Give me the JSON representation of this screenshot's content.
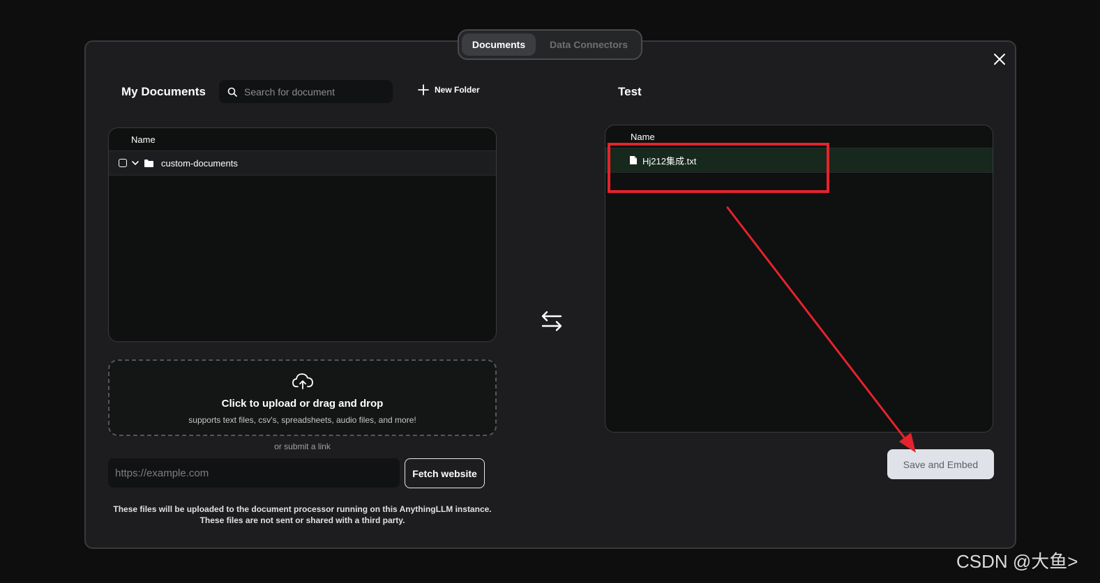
{
  "tabs": [
    {
      "label": "Documents"
    },
    {
      "label": "Data Connectors"
    }
  ],
  "my_documents": {
    "title": "My Documents",
    "search_placeholder": "Search for document",
    "new_folder_label": "New Folder",
    "column_name": "Name",
    "folders": [
      {
        "name": "custom-documents"
      }
    ]
  },
  "upload": {
    "title": "Click to upload or drag and drop",
    "subtitle": "supports text files, csv's, spreadsheets, audio files, and more!",
    "or_link": "or submit a link",
    "url_placeholder": "https://example.com",
    "fetch_label": "Fetch website",
    "note_line1": "These files will be uploaded to the document processor running on this AnythingLLM instance.",
    "note_line2": "These files are not sent or shared with a third party."
  },
  "workspace": {
    "title": "Test",
    "column_name": "Name",
    "files": [
      {
        "name": "Hj212集成.txt"
      }
    ],
    "save_label": "Save and Embed"
  },
  "watermark": "CSDN @大鱼>",
  "colors": {
    "background": "#0e0e0f",
    "modal": "#1d1d1f",
    "selected_row": "#16291c",
    "annotation": "#e5232c",
    "save_button": "#dfe3e9"
  }
}
